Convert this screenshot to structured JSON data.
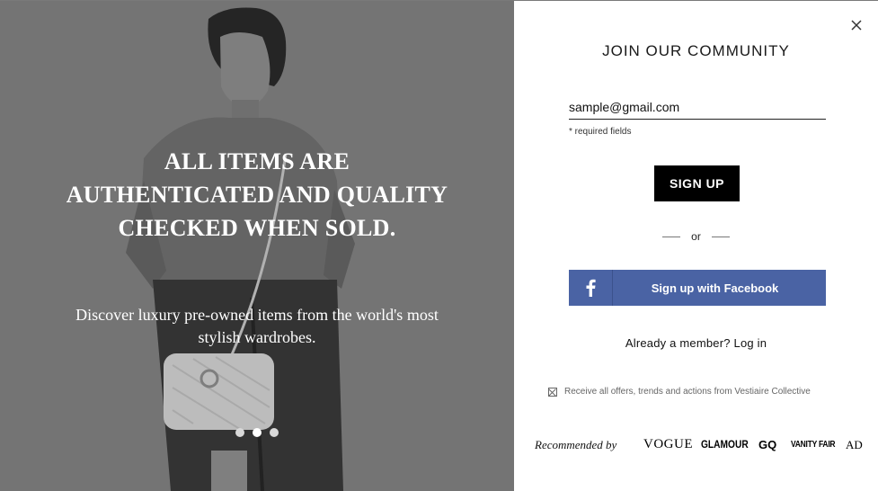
{
  "hero": {
    "heading": "ALL ITEMS ARE AUTHENTICATED AND QUALITY CHECKED WHEN SOLD.",
    "subheading": "Discover luxury pre-owned items from the world's most stylish wardrobes.",
    "carousel_total": 3,
    "carousel_active_index": 1
  },
  "panel": {
    "title": "JOIN OUR COMMUNITY",
    "email_value": "sample@gmail.com",
    "required_note": "* required fields",
    "signup_label": "SIGN UP",
    "or_label": "or",
    "facebook_label": "Sign up with Facebook",
    "login_prompt": "Already a member? Log in",
    "offers_label": "Receive all offers, trends and actions from Vestiaire Collective",
    "recommended_label": "Recommended by",
    "brands": [
      "VOGUE",
      "GLAMOUR",
      "GQ",
      "VANITY FAIR",
      "AD"
    ]
  },
  "colors": {
    "facebook": "#4a63a4",
    "signup_button": "#000000"
  },
  "icons": {
    "close": "close-icon",
    "facebook": "facebook-icon",
    "checkbox": "checkbox-icon"
  }
}
